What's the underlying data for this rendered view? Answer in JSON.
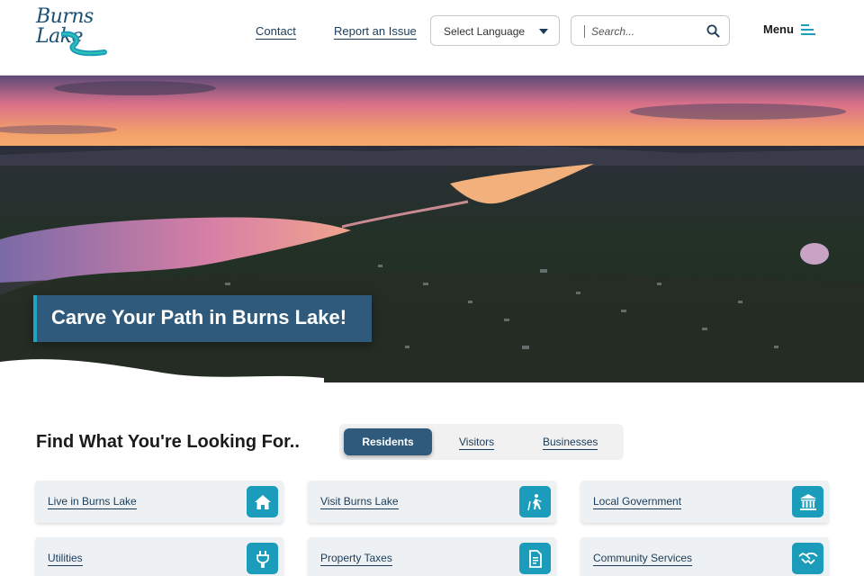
{
  "site": {
    "logo_line1": "Burns",
    "logo_line2": "Lake",
    "brand_color": "#1b4f73",
    "accent_color": "#1a9cba"
  },
  "header": {
    "nav_contact": "Contact",
    "nav_report": "Report an Issue",
    "language_select": "Select Language",
    "search_placeholder": "Search...",
    "menu_label": "Menu",
    "search_icon": "search-icon",
    "menu_icon": "menu-lines-icon"
  },
  "hero": {
    "title": "Carve Your Path in Burns Lake!"
  },
  "find": {
    "title": "Find What You're Looking For..",
    "tabs": [
      {
        "label": "Residents",
        "active": true
      },
      {
        "label": "Visitors",
        "active": false
      },
      {
        "label": "Businesses",
        "active": false
      }
    ],
    "cards": [
      {
        "label": "Live in Burns Lake",
        "icon": "house-icon"
      },
      {
        "label": "Visit Burns Lake",
        "icon": "hiker-icon"
      },
      {
        "label": "Local Government",
        "icon": "government-building-icon"
      },
      {
        "label": "Utilities",
        "icon": "plug-icon"
      },
      {
        "label": "Property Taxes",
        "icon": "document-icon"
      },
      {
        "label": "Community Services",
        "icon": "handshake-icon"
      }
    ]
  }
}
